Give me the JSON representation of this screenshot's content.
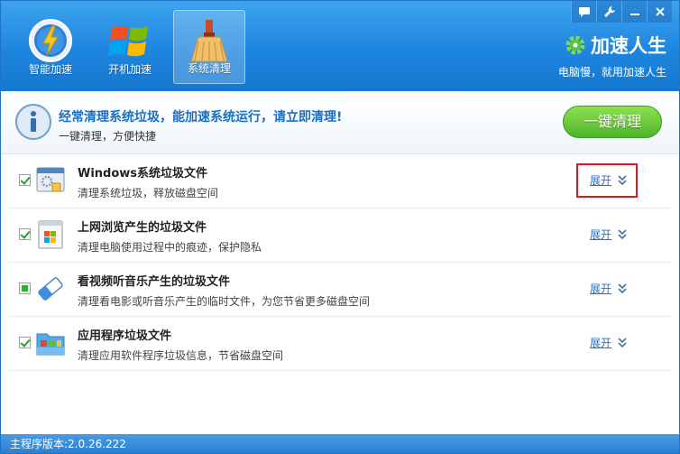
{
  "nav": {
    "items": [
      {
        "label": "智能加速",
        "icon": "lightning-gauge-icon"
      },
      {
        "label": "开机加速",
        "icon": "windows-logo-icon"
      },
      {
        "label": "系统清理",
        "icon": "broom-icon"
      }
    ],
    "active_index": 2
  },
  "window_controls": {
    "feedback": "message-icon",
    "settings": "wrench-icon",
    "minimize": "minimize-icon",
    "close": "close-icon"
  },
  "brand": {
    "title": "加速人生",
    "subtitle": "电脑慢，就用加速人生",
    "icon": "gear-icon"
  },
  "banner": {
    "title": "经常清理系统垃圾，能加速系统运行，请立即清理!",
    "subtitle": "一键清理，方便快捷",
    "button_label": "一键清理"
  },
  "items": [
    {
      "title": "Windows系统垃圾文件",
      "desc": "清理系统垃圾，释放磁盘空间",
      "expand": "展开",
      "checked": "checked",
      "icon": "system-window-icon"
    },
    {
      "title": "上网浏览产生的垃圾文件",
      "desc": "清理电脑使用过程中的痕迹，保护隐私",
      "expand": "展开",
      "checked": "checked",
      "icon": "browser-window-icon"
    },
    {
      "title": "看视频听音乐产生的垃圾文件",
      "desc": "清理看电影或听音乐产生的临时文件，为您节省更多磁盘空间",
      "expand": "展开",
      "checked": "partial",
      "icon": "eraser-icon"
    },
    {
      "title": "应用程序垃圾文件",
      "desc": "清理应用软件程序垃圾信息，节省磁盘空间",
      "expand": "展开",
      "checked": "checked",
      "icon": "folder-apps-icon"
    }
  ],
  "status": {
    "version_text": "主程序版本:2.0.26.222"
  },
  "colors": {
    "header": "#1e86df",
    "accent_blue": "#1a6fc4",
    "button_green": "#4cb52a",
    "highlight_red": "#e0161b"
  }
}
